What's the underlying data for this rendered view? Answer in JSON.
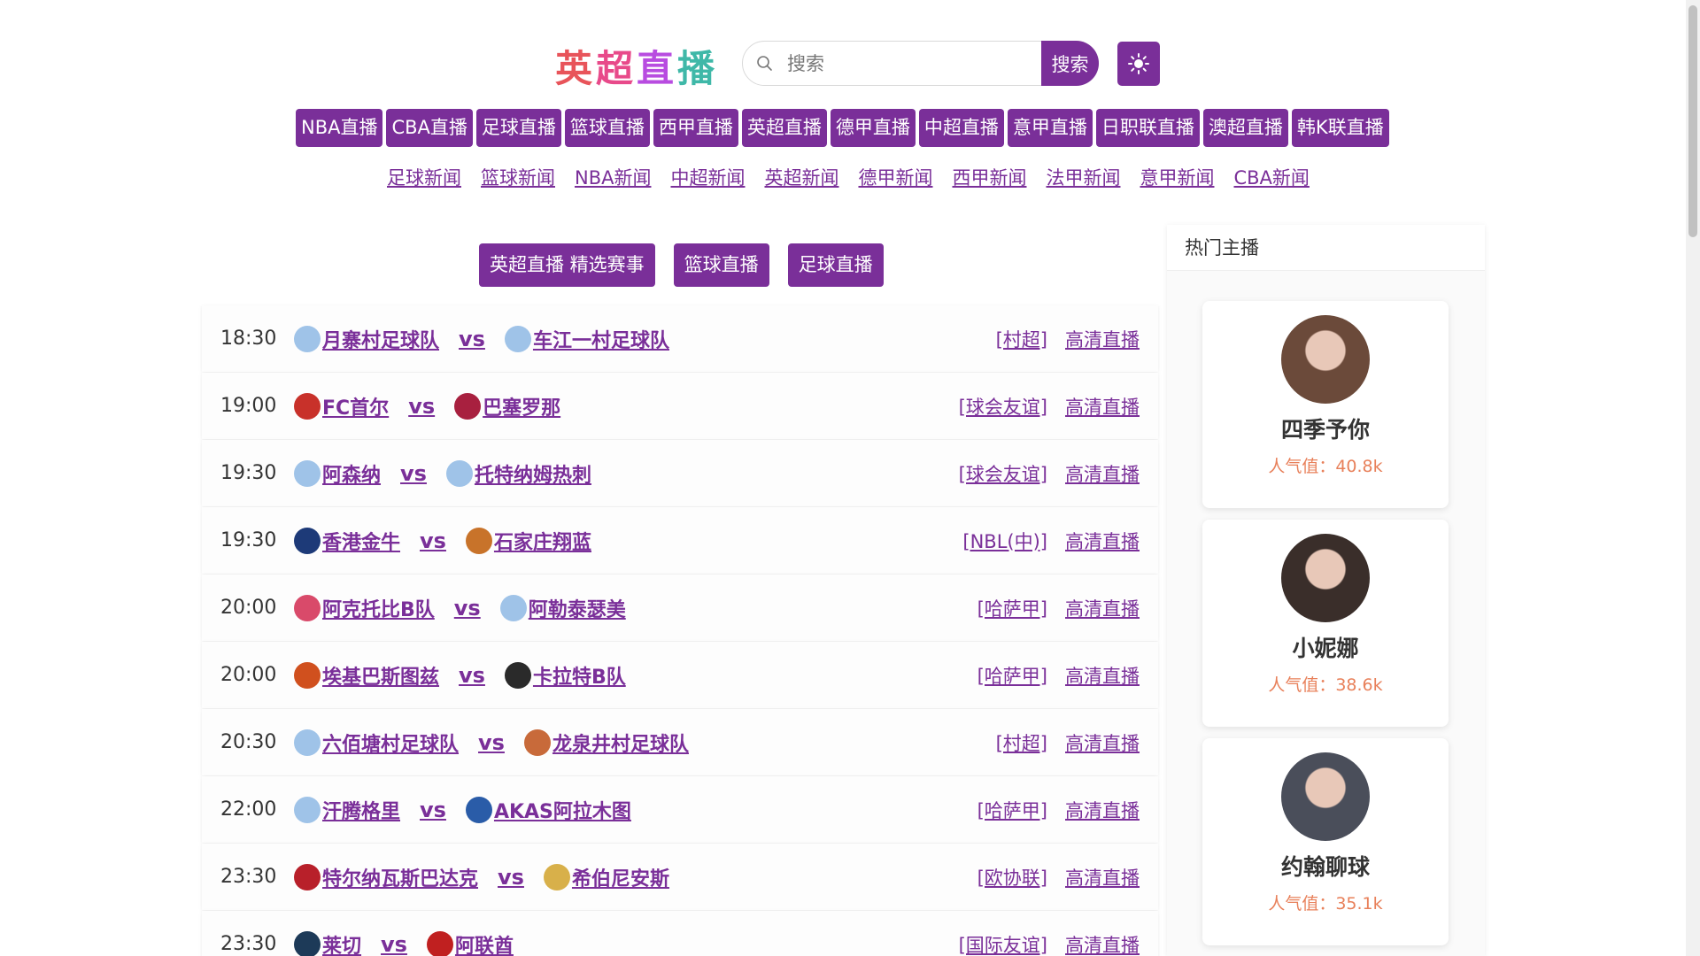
{
  "logo": {
    "chars": [
      "英",
      "超",
      "直",
      "播"
    ]
  },
  "search": {
    "placeholder": "搜索",
    "button_label": "搜索"
  },
  "nav_primary": [
    "NBA直播",
    "CBA直播",
    "足球直播",
    "篮球直播",
    "西甲直播",
    "英超直播",
    "德甲直播",
    "中超直播",
    "意甲直播",
    "日职联直播",
    "澳超直播",
    "韩K联直播"
  ],
  "nav_news": [
    "足球新闻",
    "篮球新闻",
    "NBA新闻",
    "中超新闻",
    "英超新闻",
    "德甲新闻",
    "西甲新闻",
    "法甲新闻",
    "意甲新闻",
    "CBA新闻"
  ],
  "tabs": [
    "英超直播 精选赛事",
    "篮球直播",
    "足球直播"
  ],
  "matches": [
    {
      "time": "18:30",
      "home": "月寨村足球队",
      "away": "车江一村足球队",
      "vs": "vs",
      "league": "[村超]",
      "live": "高清直播",
      "home_color": "#9fc3e8",
      "away_color": "#9fc3e8"
    },
    {
      "time": "19:00",
      "home": "FC首尔",
      "away": "巴塞罗那",
      "vs": "vs",
      "league": "[球会友谊]",
      "live": "高清直播",
      "home_color": "#c8312a",
      "away_color": "#a8203f"
    },
    {
      "time": "19:30",
      "home": "阿森纳",
      "away": "托特纳姆热刺",
      "vs": "vs",
      "league": "[球会友谊]",
      "live": "高清直播",
      "home_color": "#9fc3e8",
      "away_color": "#9fc3e8"
    },
    {
      "time": "19:30",
      "home": "香港金牛",
      "away": "石家庄翔蓝",
      "vs": "vs",
      "league": "[NBL(中)]",
      "live": "高清直播",
      "home_color": "#1d3a78",
      "away_color": "#c8732a"
    },
    {
      "time": "20:00",
      "home": "阿克托比B队",
      "away": "阿勒泰瑟美",
      "vs": "vs",
      "league": "[哈萨甲]",
      "live": "高清直播",
      "home_color": "#d94a6a",
      "away_color": "#9fc3e8"
    },
    {
      "time": "20:00",
      "home": "埃基巴斯图兹",
      "away": "卡拉特B队",
      "vs": "vs",
      "league": "[哈萨甲]",
      "live": "高清直播",
      "home_color": "#d0501e",
      "away_color": "#2a2a2a"
    },
    {
      "time": "20:30",
      "home": "六佰塘村足球队",
      "away": "龙泉井村足球队",
      "vs": "vs",
      "league": "[村超]",
      "live": "高清直播",
      "home_color": "#9fc3e8",
      "away_color": "#c86a3a"
    },
    {
      "time": "22:00",
      "home": "汗腾格里",
      "away": "AKAS阿拉木图",
      "vs": "vs",
      "league": "[哈萨甲]",
      "live": "高清直播",
      "home_color": "#9fc3e8",
      "away_color": "#2a5ca8"
    },
    {
      "time": "23:30",
      "home": "特尔纳瓦斯巴达克",
      "away": "希伯尼安斯",
      "vs": "vs",
      "league": "[欧协联]",
      "live": "高清直播",
      "home_color": "#b8202a",
      "away_color": "#d8b04a"
    },
    {
      "time": "23:30",
      "home": "莱切",
      "away": "阿联酋",
      "vs": "vs",
      "league": "[国际友谊]",
      "live": "高清直播",
      "home_color": "#1d3a58",
      "away_color": "#c02020"
    }
  ],
  "sidebar": {
    "title": "热门主播",
    "anchors": [
      {
        "name": "四季予你",
        "pop_label": "人气值：",
        "pop_value": "40.8k",
        "avatar_color": "#6b4a3a"
      },
      {
        "name": "小妮娜",
        "pop_label": "人气值：",
        "pop_value": "38.6k",
        "avatar_color": "#3a2e2a"
      },
      {
        "name": "约翰聊球",
        "pop_label": "人气值：",
        "pop_value": "35.1k",
        "avatar_color": "#4a4e5a"
      }
    ]
  },
  "colors": {
    "accent": "#7a2f99",
    "popularity": "#e8805a"
  }
}
